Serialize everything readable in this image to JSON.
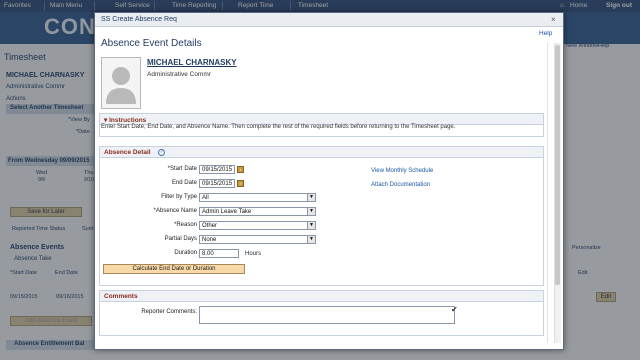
{
  "topnav": {
    "items": [
      "Favorites",
      "Main Menu",
      "Self Service",
      "Time Reporting",
      "Report Time",
      "Timesheet"
    ],
    "home": "Home",
    "signout": "Sign out"
  },
  "background": {
    "logo": "CONN",
    "page_title": "Timesheet",
    "employee_name": "MICHAEL CHARNASKY",
    "employee_title": "Administrative Commr",
    "actions": "Actions",
    "select_another": "Select Another Timesheet",
    "view_by": "*View By",
    "date": "*Date",
    "from_label": "From Wednesday 09/09/2015",
    "wed": "Wed",
    "wed_date": "9/9",
    "thu": "Thu",
    "thu_date": "9/10",
    "save_for_later": "Save for Later",
    "reported_time_status": "Reported Time Status",
    "sum_tab": "Sum",
    "absence_events": "Absence Events",
    "absence_take": "Absence Take",
    "start_date": "*Start Date",
    "end_date": "End Date",
    "start_value": "09/15/2015",
    "end_value": "09/16/2015",
    "add_absence_event": "Add Absence Event",
    "absence_entitlement": "Absence Entitlement Bal",
    "new_window": "New Window",
    "help": "Help",
    "personalize": "Personalize",
    "edit": "Edit"
  },
  "modal": {
    "title": "SS Create Absence Req",
    "close": "×",
    "help": "Help",
    "heading": "Absence Event Details",
    "employee": {
      "name": "MICHAEL CHARNASKY",
      "title": "Administrative Commr"
    },
    "instructions": {
      "title": "Instructions",
      "text": "Enter Start Date, End Date, and Absence Name. Then complete the rest of the required fields before returning to the Timesheet page."
    },
    "absence_detail": {
      "title": "Absence Detail",
      "help_icon": "?",
      "start_date_label": "*Start Date",
      "start_date": "09/15/2015",
      "end_date_label": "End Date",
      "end_date": "09/15/2015",
      "filter_label": "Filter by Type",
      "filter_value": "All",
      "absence_name_label": "*Absence Name",
      "absence_name_value": "Admin Leave Take",
      "reason_label": "*Reason",
      "reason_value": "Other",
      "partial_days_label": "Partial Days",
      "partial_days_value": "None",
      "duration_label": "Duration",
      "duration_value": "8.00",
      "duration_unit": "Hours",
      "calc_button": "Calculate End Date or Duration",
      "view_monthly_schedule": "View Monthly Schedule",
      "attach_documentation": "Attach Documentation"
    },
    "comments": {
      "title": "Comments",
      "reporter_label": "Reporter Comments:"
    }
  },
  "colors": {
    "nav": "#2a4a78",
    "accent_link": "#1a57a6",
    "section_title": "#8b2b1e",
    "button_gold": "#f6d9a6"
  }
}
